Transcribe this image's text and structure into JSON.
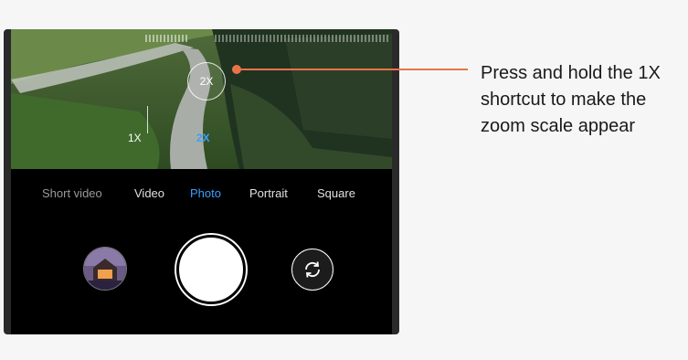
{
  "camera": {
    "zoom_bubble": "2X",
    "zoom_scale": {
      "min_label": "1X",
      "current_label": "2X"
    },
    "modes": [
      {
        "label": "Short video",
        "active": false
      },
      {
        "label": "Video",
        "active": false
      },
      {
        "label": "Photo",
        "active": true
      },
      {
        "label": "Portrait",
        "active": false
      },
      {
        "label": "Square",
        "active": false
      }
    ],
    "accent_color": "#3aa0ff"
  },
  "callout": {
    "text": "Press and hold the 1X shortcut to make the zoom scale appear",
    "line_color": "#e8744a"
  }
}
